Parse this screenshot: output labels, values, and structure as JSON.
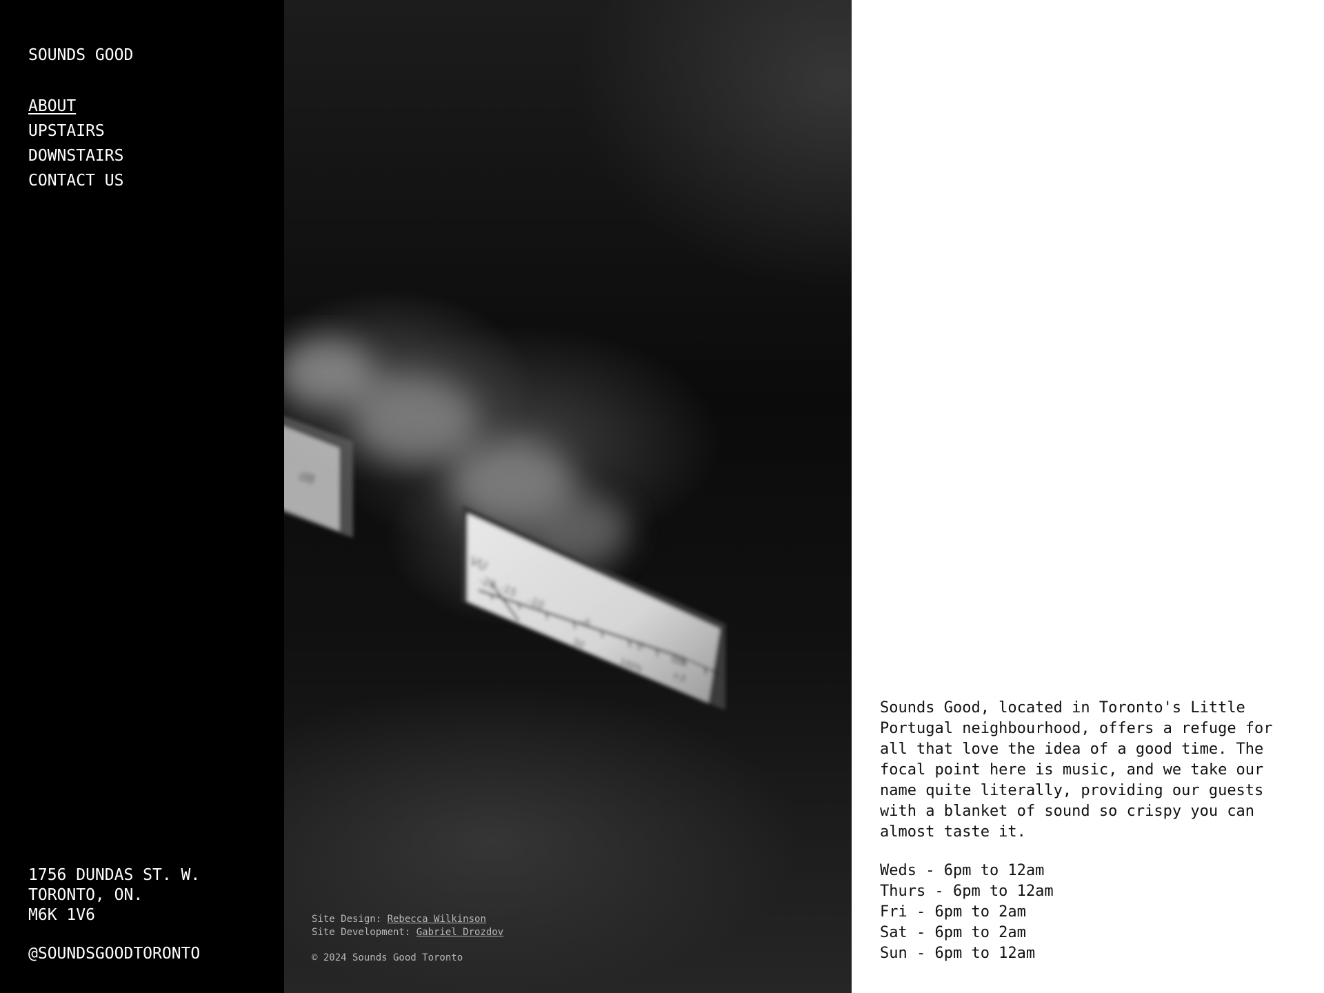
{
  "brand": "SOUNDS GOOD",
  "nav": {
    "items": [
      {
        "label": "ABOUT",
        "active": true
      },
      {
        "label": "UPSTAIRS",
        "active": false
      },
      {
        "label": "DOWNSTAIRS",
        "active": false
      },
      {
        "label": "CONTACT US",
        "active": false
      }
    ]
  },
  "address": {
    "line1": "1756 DUNDAS ST. W.",
    "line2": "TORONTO, ON.",
    "line3": "M6K 1V6"
  },
  "social": "@SOUNDSGOODTORONTO",
  "photo": {
    "meter_labels": {
      "vu": "VU",
      "db": "dB",
      "scale": [
        "-20",
        "-15",
        "-10",
        "-5",
        "0",
        "+3"
      ],
      "percent": [
        "50",
        "100%"
      ]
    }
  },
  "credits": {
    "design_prefix": "Site Design: ",
    "design_name": "Rebecca Wilkinson",
    "dev_prefix": "Site Development: ",
    "dev_name": "Gabriel Drozdov",
    "copyright": "© 2024 Sounds Good Toronto"
  },
  "about": {
    "description": "Sounds Good, located in Toronto's Little\nPortugal neighbourhood, offers a refuge for\nall that love the idea of a good time. The\nfocal point here is music, and we take our\nname quite literally, providing our guests\nwith a blanket of sound so crispy you can\nalmost taste it."
  },
  "hours": [
    "Weds - 6pm to 12am",
    "Thurs - 6pm to 12am",
    "Fri - 6pm to 2am",
    "Sat - 6pm to 2am",
    "Sun - 6pm to 12am"
  ],
  "colors": {
    "sidebar_bg": "#000000",
    "sidebar_text": "#ffffff",
    "content_bg": "#ffffff",
    "content_text": "#111111",
    "credit_text": "#b8b8b8"
  }
}
